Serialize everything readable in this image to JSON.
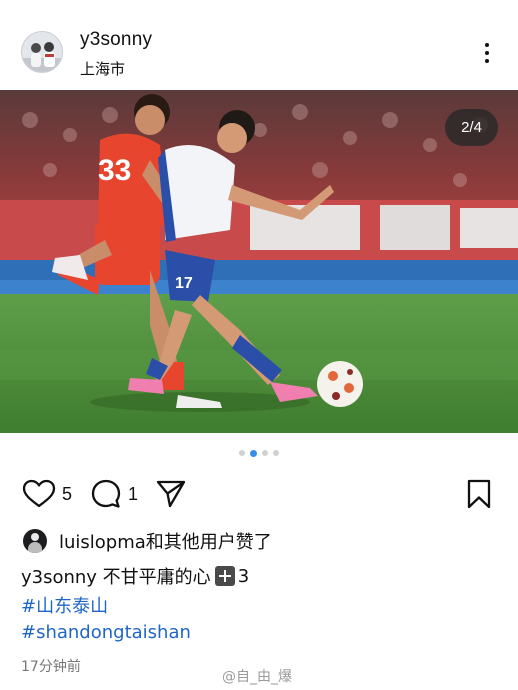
{
  "header": {
    "username": "y3sonny",
    "location": "上海市",
    "more_icon": "more-vertical-icon"
  },
  "photo": {
    "counter": "2/4",
    "jersey_red_number": "33",
    "jersey_white_number": "17"
  },
  "carousel": {
    "total": 4,
    "active_index": 1
  },
  "actions": {
    "like_icon": "heart-icon",
    "like_count": "5",
    "comment_icon": "comment-bubble-icon",
    "comment_count": "1",
    "share_icon": "send-icon",
    "bookmark_icon": "bookmark-icon"
  },
  "liked_by": {
    "text": "luislopma和其他用户赞了"
  },
  "caption": {
    "text": "y3sonny 不甘平庸的心",
    "suffix": "3"
  },
  "hashtags": [
    "#山东泰山",
    "#shandongtaishan"
  ],
  "timestamp": "17分钟前",
  "watermark": "@自_由_爆",
  "colors": {
    "hashtag": "#1f66c7",
    "carousel_active": "#3a8ee6",
    "counter_bg": "#282828"
  }
}
